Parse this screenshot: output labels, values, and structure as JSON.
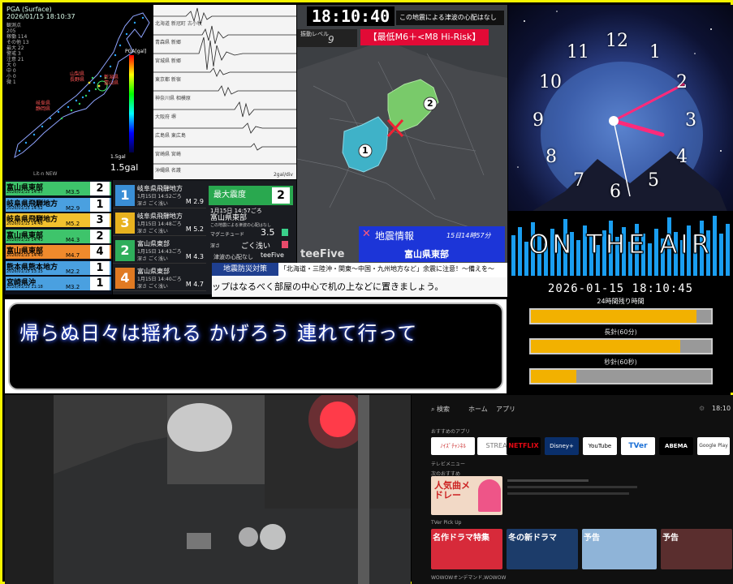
{
  "pga_panel": {
    "header_title": "PGA (Surface)",
    "header_time": "2026/01/15 18:10:37",
    "stats": [
      "観測点 205",
      "稼働 114",
      "その他 13",
      "最大 22",
      "警戒 3",
      "注意 21",
      "大 0",
      "中 0",
      "小 0",
      "微 1"
    ],
    "pga_label": "PGA[gal]",
    "scale_bottom": "1.5gal",
    "gal_value": "1.5gal",
    "map_labels": [
      "山梨県",
      "長野県",
      "岐阜県",
      "静岡県",
      "富山県",
      "新潟県"
    ],
    "brand": "Lit-n NEW"
  },
  "wave_panel": {
    "labels": [
      "北海道 新冠町 古小牧",
      "青森県 新郷",
      "宮城県 新郷",
      "東京都 新宿",
      "神奈川県 相模原",
      "大阪府 堺",
      "広島県 東広島",
      "宮崎県 宮崎",
      "沖縄県 名護"
    ],
    "footer": "2gal/div"
  },
  "quake_map": {
    "time": "18:10:40",
    "tsunami_note": "この地震による津波の心配はなし",
    "shindo_label": "振動レベル",
    "shindo_value": "9",
    "risk_label": "【最低M6＋<M8 Hi-Risk】",
    "markers": [
      "1",
      "2"
    ],
    "info_title": "地震情報",
    "info_time": "15日14時57分",
    "info_region": "富山県東部",
    "brand": "teeFive"
  },
  "clock_numbers": [
    "12",
    "1",
    "2",
    "3",
    "4",
    "5",
    "6",
    "7",
    "8",
    "9",
    "10",
    "11"
  ],
  "air_panel": {
    "logo": "ON THE AIR",
    "datetime": "2026-01-15 18:10:45",
    "remain_label": "24時間残り時間",
    "minute_label": "長針(60分)",
    "second_label": "秒針(60秒)",
    "bars": [
      0.92,
      0.83,
      0.25
    ]
  },
  "quake_list": [
    {
      "name": "富山県東部",
      "date": "2026/01/15 14:57",
      "mag": "M3.5",
      "shindo": "2",
      "color": "#3ec46b"
    },
    {
      "name": "岐阜県飛騨地方",
      "date": "2026/01/15 14:52",
      "mag": "M2.9",
      "shindo": "1",
      "color": "#4aa0e0"
    },
    {
      "name": "岐阜県飛騨地方",
      "date": "2026/01/15 14:48",
      "mag": "M5.2",
      "shindo": "3",
      "color": "#f2c12e"
    },
    {
      "name": "富山県東部",
      "date": "2026/01/15 14:43",
      "mag": "M4.3",
      "shindo": "2",
      "color": "#3ec46b"
    },
    {
      "name": "富山県東部",
      "date": "2026/01/15 14:40",
      "mag": "M4.7",
      "shindo": "4",
      "color": "#f08a2c"
    },
    {
      "name": "熊本県熊本地方",
      "date": "2026/01/15 13:15",
      "mag": "M2.2",
      "shindo": "1",
      "color": "#4aa0e0"
    },
    {
      "name": "宮崎県沖",
      "date": "2026/01/15 11:18",
      "mag": "M3.2",
      "shindo": "1",
      "color": "#4aa0e0"
    }
  ],
  "quake_detail": {
    "cards": [
      {
        "badge": "1",
        "name": "岐阜県飛騨地方",
        "time": "1月15日 14:52ごろ",
        "depth": "深さ ごく浅い",
        "mag": "M 2.9",
        "color": "#3a8fd6"
      },
      {
        "badge": "3",
        "name": "岐阜県飛騨地方",
        "time": "1月15日 14:48ごろ",
        "depth": "深さ ごく浅い",
        "mag": "M 5.2",
        "color": "#e8b21f"
      },
      {
        "badge": "2",
        "name": "富山県東部",
        "time": "1月15日 14:43ごろ",
        "depth": "深さ ごく浅い",
        "mag": "M 4.3",
        "color": "#2fae5b"
      },
      {
        "badge": "4",
        "name": "富山県東部",
        "time": "1月15日 14:40ごろ",
        "depth": "深さ ごく浅い",
        "mag": "M 4.7",
        "color": "#e07a22"
      }
    ],
    "max_label": "最大震度",
    "max_value": "2",
    "info_time": "1月15日 14:57ごろ",
    "info_region": "富山県東部",
    "info_note": "この地震による津波の心配はなし",
    "mag_label": "マグニチュード",
    "mag_value": "3.5",
    "depth_label": "深さ",
    "depth_value": "ごく浅い",
    "extra": "津波の心配なし",
    "brand": "teeFive"
  },
  "ticker": {
    "label": "地震防災対策",
    "headline": "「北海道・三陸沖・関東〜中国・九州地方など」余震に注意！〜備えを〜",
    "body": "ップはなるべく部屋の中心で机の上などに置きましょう。"
  },
  "lyric": "帰らぬ日々は揺れる かげろう 連れて行って",
  "tv": {
    "nav": [
      "検索",
      "ホーム",
      "アプリ"
    ],
    "time": "18:10",
    "section_apps": "おすすめのアプリ",
    "apps": [
      "ﾉｲｽﾞﾁｬﾝﾈﾙ",
      "STREAM",
      "NETFLIX",
      "Disney+",
      "YouTube",
      "TVer",
      "ABEMA",
      "Google Play"
    ],
    "section_tv": "テレビメニュー",
    "tile_main": "人気曲メドレー",
    "section_rec": "次のおすすめ",
    "section_pick": "TVer Pick Up",
    "tiles": [
      "名作ドラマ特集",
      "冬の新ドラマ",
      "予告",
      "予告"
    ],
    "footer": "WOWOWオンデマンド,WOWOW"
  }
}
